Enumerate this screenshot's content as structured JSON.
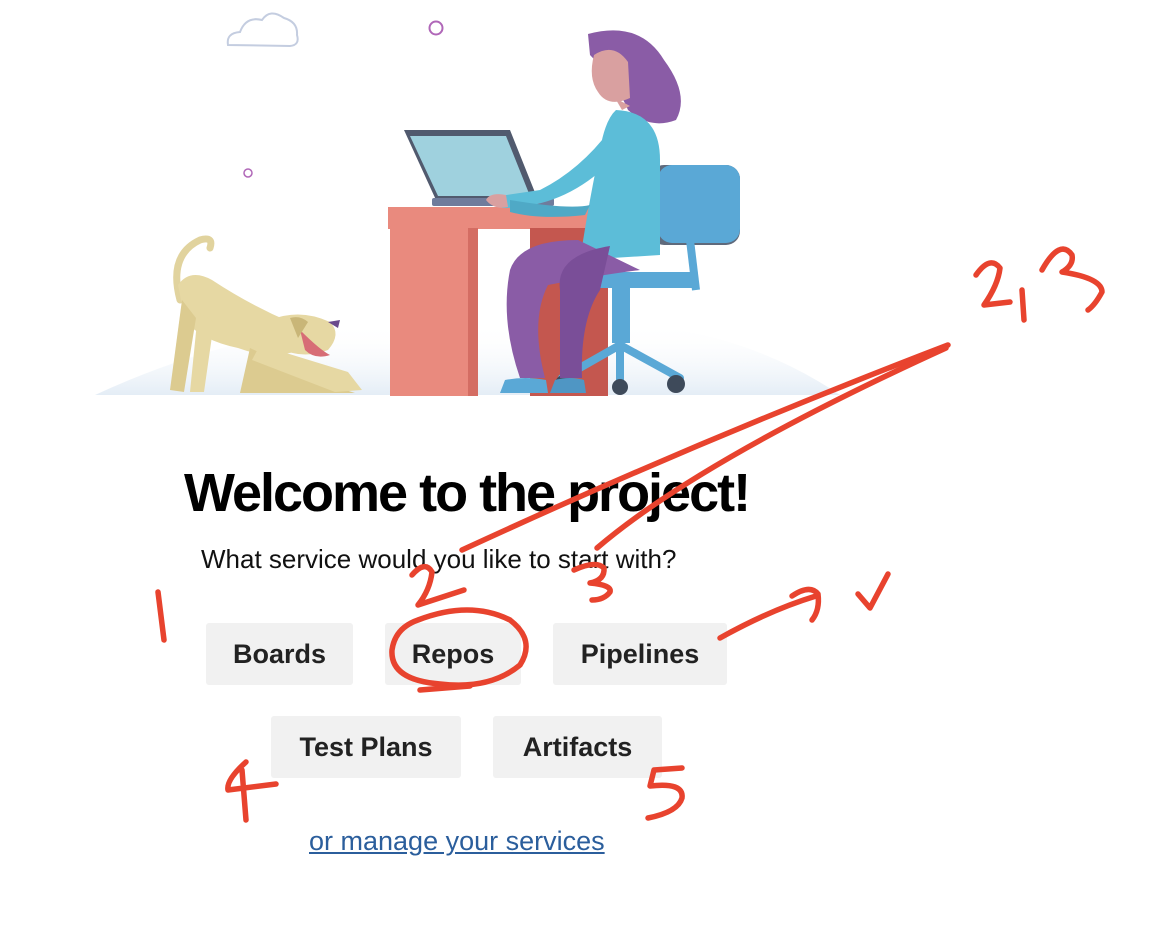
{
  "welcome": {
    "title": "Welcome to the project!",
    "subtitle": "What service would you like to start with?"
  },
  "services": {
    "boards": "Boards",
    "repos": "Repos",
    "pipelines": "Pipelines",
    "test_plans": "Test Plans",
    "artifacts": "Artifacts"
  },
  "manage_link": "or manage your services",
  "annotations": {
    "color": "#e8432e",
    "top_right_note": "2,3",
    "numbers": [
      "1",
      "2",
      "3",
      "4",
      "5"
    ]
  }
}
